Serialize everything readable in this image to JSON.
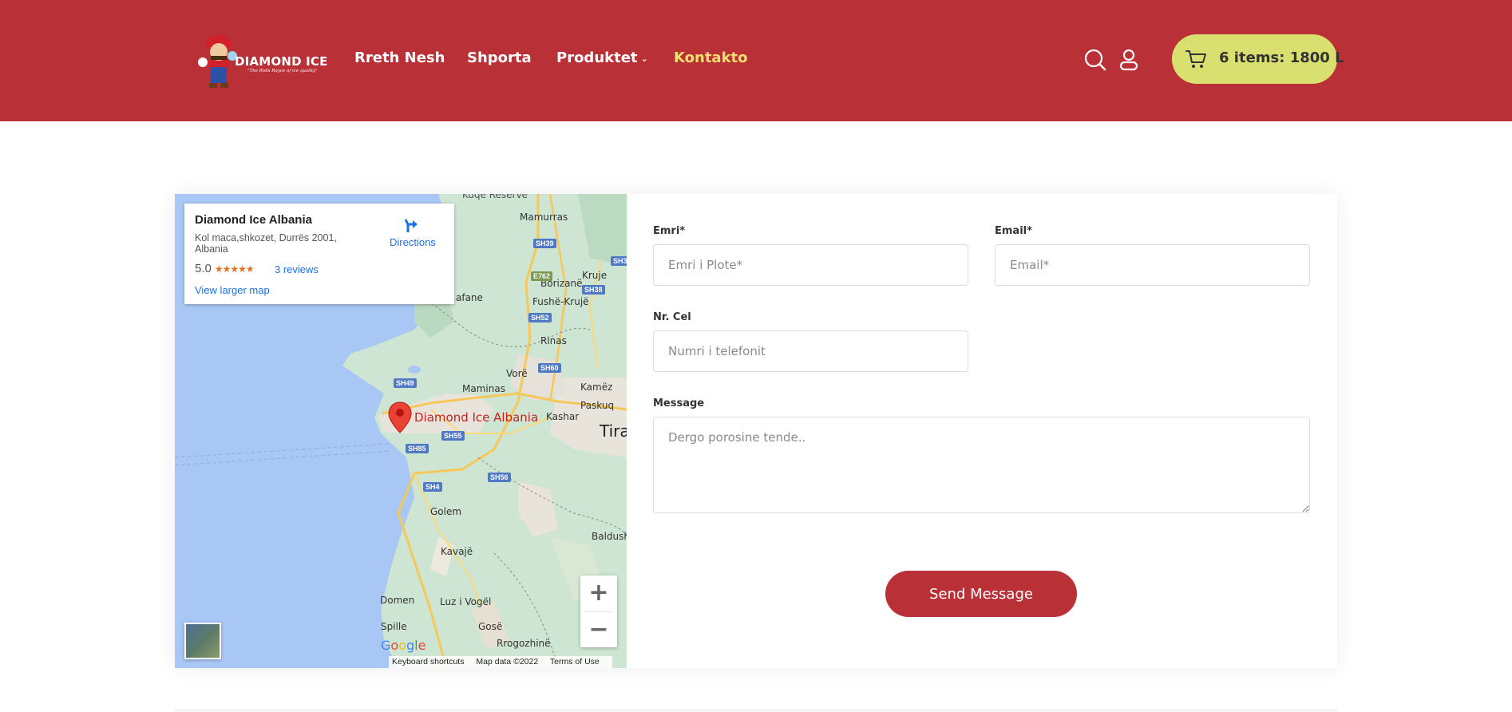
{
  "brand": {
    "name": "DIAMOND ICE",
    "tagline": "\"The Rolls Royce of ice quality\"",
    "primary_color": "#b93036",
    "accent_color": "#d9e070",
    "active_nav_color": "#f1df72"
  },
  "nav": {
    "items": [
      {
        "label": "Rreth Nesh"
      },
      {
        "label": "Shporta"
      },
      {
        "label": "Produktet",
        "has_dropdown": true
      },
      {
        "label": "Kontakto",
        "active": true
      }
    ]
  },
  "header_icons": [
    "search-icon",
    "user-icon"
  ],
  "cart": {
    "icon": "cart-icon",
    "label": "6 items: 1800 L"
  },
  "map": {
    "place_name": "Diamond Ice Albania",
    "address": "Kol maca,shkozet, Durrës 2001, Albania",
    "rating": "5.0",
    "stars": "★★★★★",
    "reviews": "3 reviews",
    "directions": "Directions",
    "view_larger": "View larger map",
    "pin_label": "Diamond Ice Albania",
    "zoom_in": "+",
    "zoom_out": "−",
    "google": "Google",
    "attribution": {
      "keyboard": "Keyboard shortcuts",
      "data": "Map data ©2022",
      "terms": "Terms of Use"
    },
    "places": [
      {
        "id": "mamurras",
        "name": "Mamurras"
      },
      {
        "id": "borizane",
        "name": "Borizanë"
      },
      {
        "id": "kruje",
        "name": "Kruje"
      },
      {
        "id": "fushe-kruje",
        "name": "Fushë-Krujë"
      },
      {
        "id": "rinas",
        "name": "Rinas"
      },
      {
        "id": "vore",
        "name": "Vorë"
      },
      {
        "id": "maminas",
        "name": "Maminas"
      },
      {
        "id": "kamez",
        "name": "Kamëz"
      },
      {
        "id": "paskuq",
        "name": "Paskuq"
      },
      {
        "id": "kashar",
        "name": "Kashar"
      },
      {
        "id": "tirana",
        "name": "Tira"
      },
      {
        "id": "golem",
        "name": "Golem"
      },
      {
        "id": "baldush",
        "name": "Baldush"
      },
      {
        "id": "kavaje",
        "name": "Kavajë"
      },
      {
        "id": "domen",
        "name": "Domen"
      },
      {
        "id": "luz",
        "name": "Luz i Vogël"
      },
      {
        "id": "spille",
        "name": "Spille"
      },
      {
        "id": "gose",
        "name": "Gosë"
      },
      {
        "id": "rrogozhine",
        "name": "Rrogozhinë"
      },
      {
        "id": "afane",
        "name": "afane"
      },
      {
        "id": "reserve",
        "name": "Kuqe Reserve"
      }
    ],
    "roads": [
      {
        "id": "sh39",
        "name": "SH39"
      },
      {
        "id": "e762",
        "name": "E762"
      },
      {
        "id": "sh38",
        "name": "SH38"
      },
      {
        "id": "sh52",
        "name": "SH52"
      },
      {
        "id": "sh60",
        "name": "SH60"
      },
      {
        "id": "sh49",
        "name": "SH49"
      },
      {
        "id": "sh55",
        "name": "SH55"
      },
      {
        "id": "sh85",
        "name": "SH85"
      },
      {
        "id": "sh56",
        "name": "SH56"
      },
      {
        "id": "sh4",
        "name": "SH4"
      },
      {
        "id": "sh3",
        "name": "SH3"
      }
    ]
  },
  "form": {
    "name_label": "Emri*",
    "name_placeholder": "Emri i Plote*",
    "email_label": "Email*",
    "email_placeholder": "Email*",
    "phone_label": "Nr. Cel",
    "phone_placeholder": "Numri i telefonit",
    "message_label": "Message",
    "message_placeholder": "Dergo porosine tende..",
    "submit": "Send Message"
  }
}
